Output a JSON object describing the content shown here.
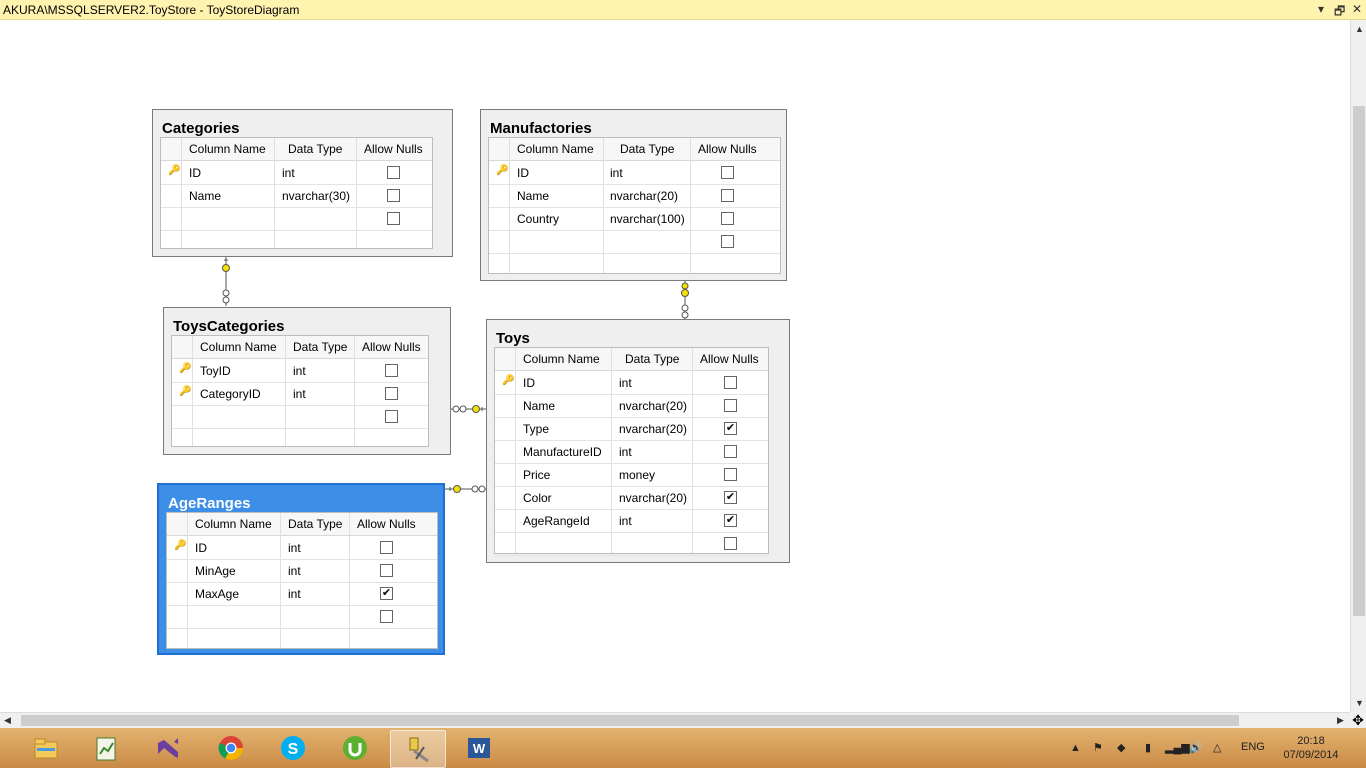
{
  "window": {
    "title": "AKURA\\MSSQLSERVER2.ToyStore - ToyStoreDiagram",
    "controls": [
      "▾",
      "🗗",
      "✕"
    ]
  },
  "headers": {
    "col_name": "Column Name",
    "data_type": "Data Type",
    "allow_nulls": "Allow Nulls"
  },
  "tables": {
    "categories": {
      "name": "Categories",
      "rows": [
        {
          "name": "ID",
          "type": "int",
          "nulls": false,
          "pk": true
        },
        {
          "name": "Name",
          "type": "nvarchar(30)",
          "nulls": false,
          "pk": false
        },
        {
          "name": "",
          "type": "",
          "nulls": false,
          "pk": false
        }
      ]
    },
    "manufactories": {
      "name": "Manufactories",
      "rows": [
        {
          "name": "ID",
          "type": "int",
          "nulls": false,
          "pk": true
        },
        {
          "name": "Name",
          "type": "nvarchar(20)",
          "nulls": false,
          "pk": false
        },
        {
          "name": "Country",
          "type": "nvarchar(100)",
          "nulls": false,
          "pk": false
        },
        {
          "name": "",
          "type": "",
          "nulls": false,
          "pk": false
        }
      ]
    },
    "toyscategories": {
      "name": "ToysCategories",
      "rows": [
        {
          "name": "ToyID",
          "type": "int",
          "nulls": false,
          "pk": true
        },
        {
          "name": "CategoryID",
          "type": "int",
          "nulls": false,
          "pk": true
        },
        {
          "name": "",
          "type": "",
          "nulls": false,
          "pk": false
        }
      ]
    },
    "toys": {
      "name": "Toys",
      "rows": [
        {
          "name": "ID",
          "type": "int",
          "nulls": false,
          "pk": true
        },
        {
          "name": "Name",
          "type": "nvarchar(20)",
          "nulls": false,
          "pk": false
        },
        {
          "name": "Type",
          "type": "nvarchar(20)",
          "nulls": true,
          "pk": false
        },
        {
          "name": "ManufactureID",
          "type": "int",
          "nulls": false,
          "pk": false
        },
        {
          "name": "Price",
          "type": "money",
          "nulls": false,
          "pk": false
        },
        {
          "name": "Color",
          "type": "nvarchar(20)",
          "nulls": true,
          "pk": false
        },
        {
          "name": "AgeRangeId",
          "type": "int",
          "nulls": true,
          "pk": false
        },
        {
          "name": "",
          "type": "",
          "nulls": false,
          "pk": false
        }
      ]
    },
    "ageranges": {
      "name": "AgeRanges",
      "rows": [
        {
          "name": "ID",
          "type": "int",
          "nulls": false,
          "pk": true
        },
        {
          "name": "MinAge",
          "type": "int",
          "nulls": false,
          "pk": false
        },
        {
          "name": "MaxAge",
          "type": "int",
          "nulls": true,
          "pk": false
        },
        {
          "name": "",
          "type": "",
          "nulls": false,
          "pk": false
        }
      ]
    }
  },
  "taskbar": {
    "apps": [
      "file-explorer",
      "project-app",
      "visual-studio",
      "chrome",
      "skype",
      "utorrent",
      "sql-server-management-studio",
      "word"
    ],
    "language": "ENG",
    "time": "20:18",
    "date": "07/09/2014"
  }
}
